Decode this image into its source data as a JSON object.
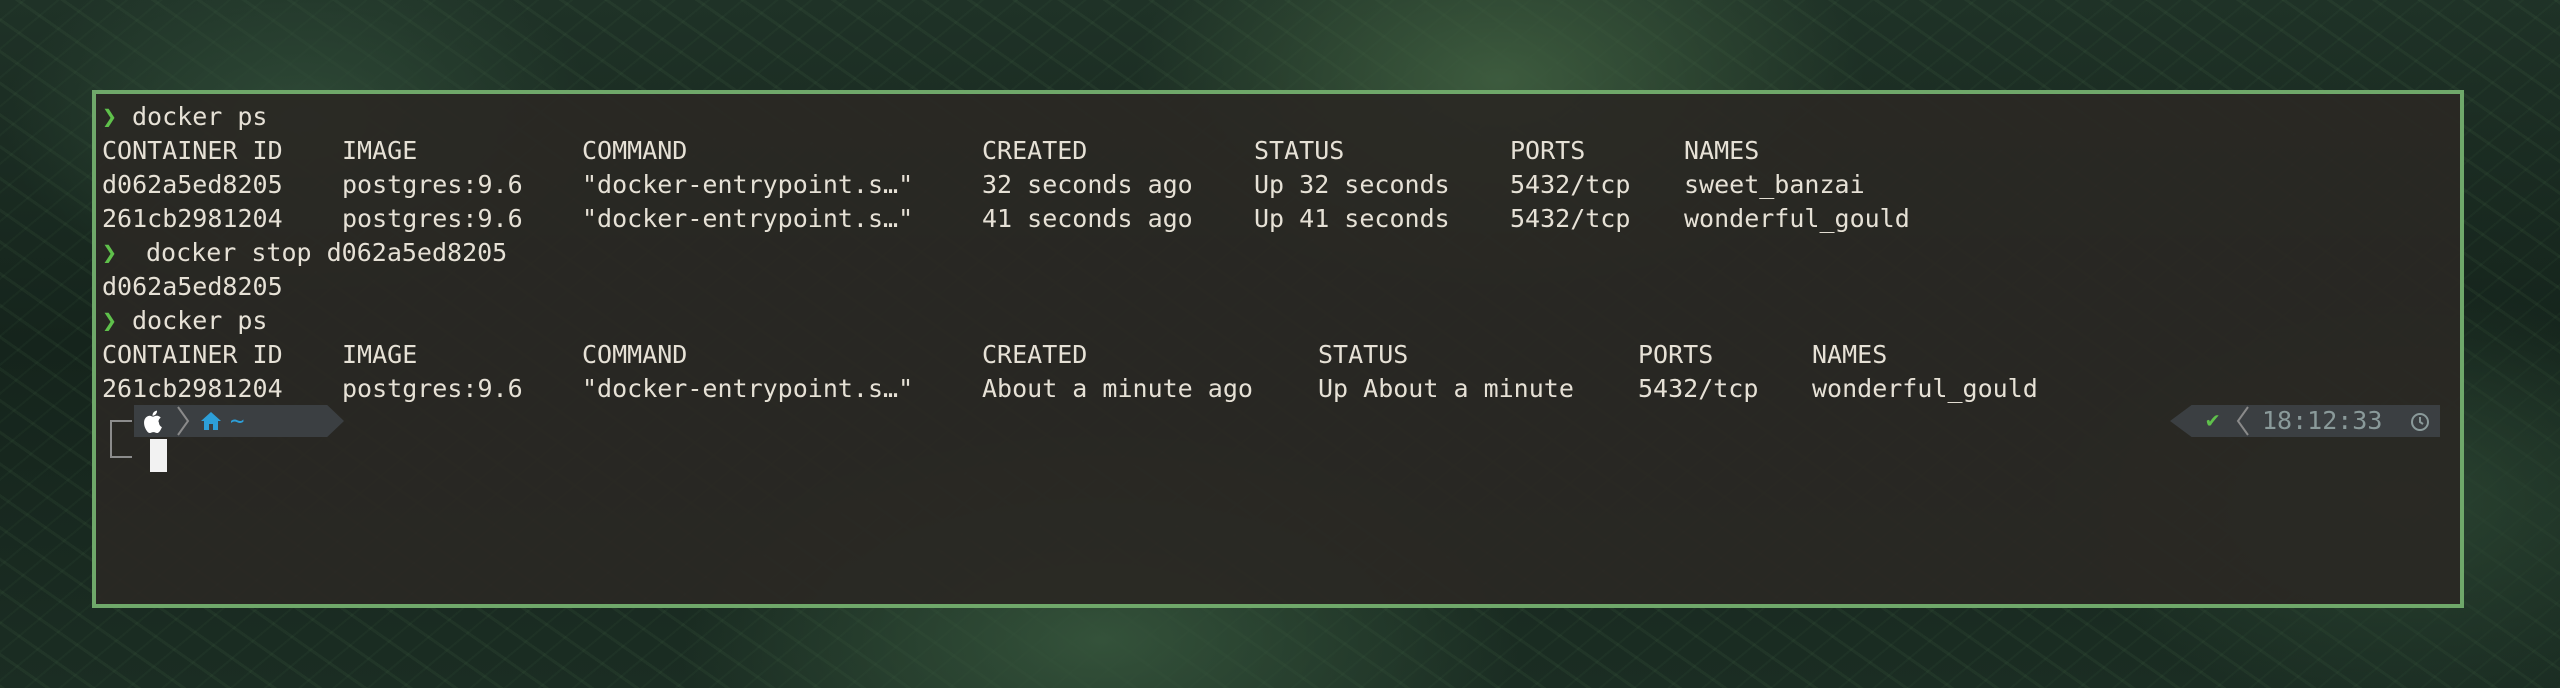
{
  "commands": {
    "first": "docker ps",
    "stop": "docker stop d062a5ed8205",
    "second": "docker ps"
  },
  "prompt_symbol": "❯",
  "ps1": {
    "headers": [
      "CONTAINER ID",
      "IMAGE",
      "COMMAND",
      "CREATED",
      "STATUS",
      "PORTS",
      "NAMES"
    ],
    "rows": [
      [
        "d062a5ed8205",
        "postgres:9.6",
        "\"docker-entrypoint.s…\"",
        "32 seconds ago",
        "Up 32 seconds",
        "5432/tcp",
        "sweet_banzai"
      ],
      [
        "261cb2981204",
        "postgres:9.6",
        "\"docker-entrypoint.s…\"",
        "41 seconds ago",
        "Up 41 seconds",
        "5432/tcp",
        "wonderful_gould"
      ]
    ]
  },
  "stop_output": "d062a5ed8205",
  "ps2": {
    "headers": [
      "CONTAINER ID",
      "IMAGE",
      "COMMAND",
      "CREATED",
      "STATUS",
      "PORTS",
      "NAMES"
    ],
    "rows": [
      [
        "261cb2981204",
        "postgres:9.6",
        "\"docker-entrypoint.s…\"",
        "About a minute ago",
        "Up About a minute",
        "5432/tcp",
        "wonderful_gould"
      ]
    ]
  },
  "powerline": {
    "os_icon": "apple-icon",
    "home_icon": "home-icon",
    "dir": "~",
    "check": "✔",
    "time": "18:12:33",
    "clock_icon": "clock-icon"
  },
  "colors": {
    "border": "#6fa86a",
    "prompt_arrow": "#5fc14b",
    "dir_blue": "#2d9fd8",
    "time_gray": "#8a9a9a"
  }
}
